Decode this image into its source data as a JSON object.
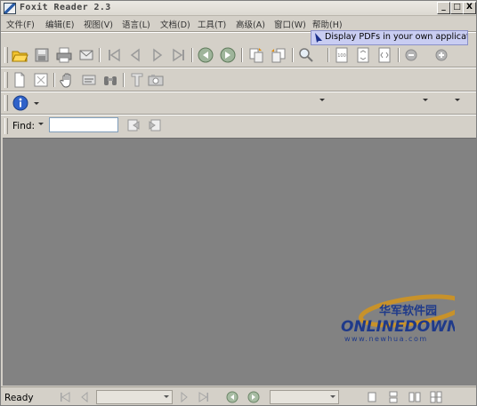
{
  "window": {
    "title": "Foxit Reader 2.3",
    "buttons": {
      "minimize": "_",
      "maximize": "□",
      "close": "X"
    }
  },
  "menu": [
    {
      "label": "文件(F)"
    },
    {
      "label": "编辑(E)"
    },
    {
      "label": "视图(V)"
    },
    {
      "label": "语言(L)"
    },
    {
      "label": "文档(D)"
    },
    {
      "label": "工具(T)"
    },
    {
      "label": "高级(A)"
    },
    {
      "label": "窗口(W)"
    },
    {
      "label": "帮助(H)"
    }
  ],
  "banner": {
    "text": "Display PDFs in your own applications"
  },
  "find": {
    "label": "Find:",
    "value": ""
  },
  "watermark": {
    "cn": "华军软件园",
    "brand": "ONLINEDOWN",
    "url": "www.newhua.com"
  },
  "status": {
    "text": "Ready",
    "page_value": "",
    "zoom_value": ""
  },
  "colors": {
    "doc_bg": "#828282",
    "chrome": "#d4d0c8",
    "banner_bg": "#c9cdf2"
  }
}
